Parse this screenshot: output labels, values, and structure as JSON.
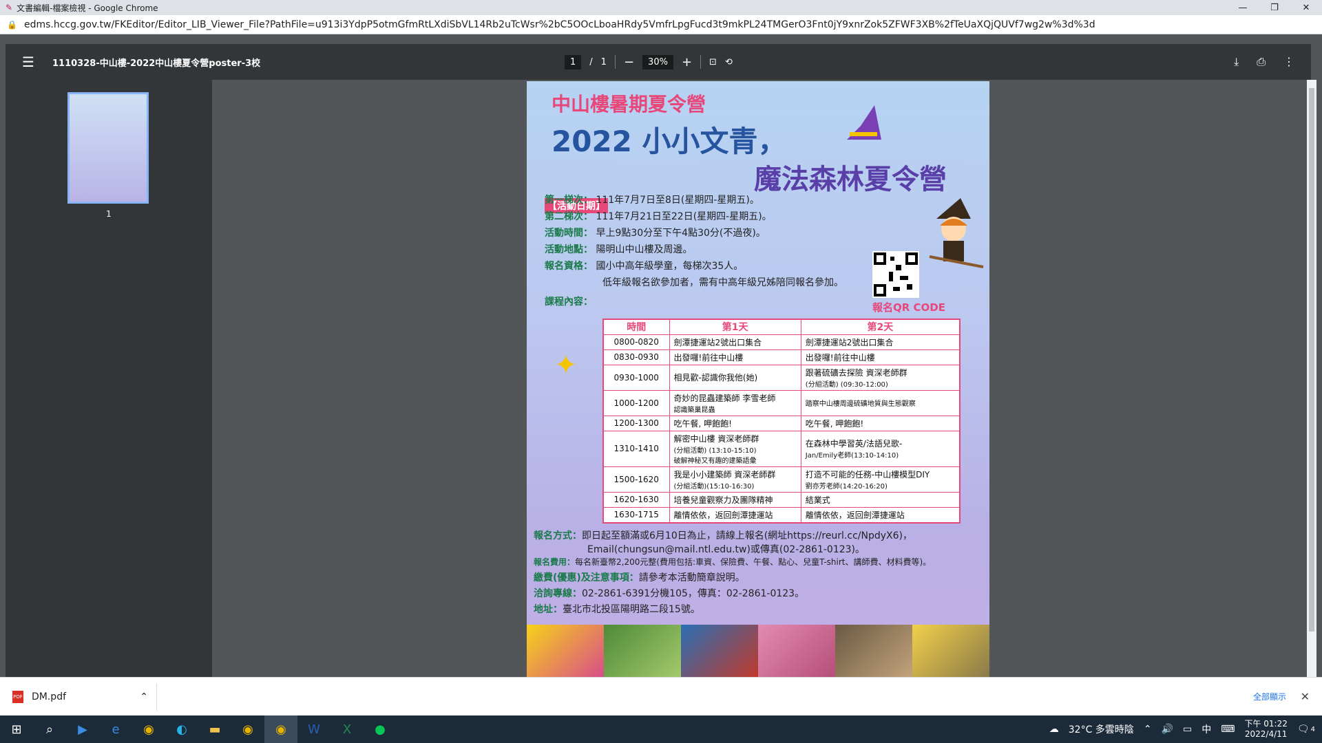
{
  "window": {
    "title": "文書編輯-檔案檢視 - Google Chrome"
  },
  "address": {
    "url": "edms.hccg.gov.tw/FKEditor/Editor_LIB_Viewer_File?PathFile=u913i3YdpP5otmGfmRtLXdiSbVL14Rb2uTcWsr%2bC5OOcLboaHRdy5VmfrLpgFucd3t9mkPL24TMGerO3Fnt0jY9xnrZok5ZFWF3XB%2fTeUaXQjQUVf7wg2w%3d%3d"
  },
  "pdf": {
    "doc_name": "1110328-中山樓-2022中山樓夏令營poster-3校",
    "page_current": "1",
    "page_sep": "/",
    "page_total": "1",
    "zoom": "30%",
    "thumb_label": "1"
  },
  "poster": {
    "line1": "中山樓暑期夏令營",
    "line2": "2022 小小文青，",
    "line3": "魔法森林夏令營",
    "date_tag": "【活動日期】",
    "batch1_k": "第一梯次：",
    "batch1_v": "111年7月7日至8日(星期四-星期五)。",
    "batch2_k": "第二梯次：",
    "batch2_v": "111年7月21日至22日(星期四-星期五)。",
    "time_k": "活動時間：",
    "time_v": "早上9點30分至下午4點30分(不過夜)。",
    "place_k": "活動地點：",
    "place_v": "陽明山中山樓及周邊。",
    "elig_k": "報名資格：",
    "elig_v": "國小中高年級學童，每梯次35人。",
    "elig_v2": "低年級報名欲參加者，需有中高年級兄姊陪同報名參加。",
    "qr_label": "報名QR CODE",
    "course_k": "課程內容：",
    "table_headers": [
      "時間",
      "第1天",
      "第2天"
    ],
    "rows": [
      {
        "t": "0800-0820",
        "d1": "劍潭捷運站2號出口集合",
        "d1b": "",
        "d2": "劍潭捷運站2號出口集合",
        "d2b": ""
      },
      {
        "t": "0830-0930",
        "d1": "出發囉!前往中山樓",
        "d1b": "",
        "d2": "出發囉!前往中山樓",
        "d2b": ""
      },
      {
        "t": "0930-1000",
        "d1": "相見歡-認識你我他(她)",
        "d1b": "",
        "d2": "跟著硫礦去探險 資深老師群",
        "d2b": "(分組活動) (09:30-12:00)"
      },
      {
        "t": "1000-1200",
        "d1": "奇妙的昆蟲建築師 李雪老師",
        "d1b": "認識築巢昆蟲",
        "d2": "",
        "d2b": "踏察中山樓周邊硫礦地質與生態觀察"
      },
      {
        "t": "1200-1300",
        "d1": "吃午餐, 呷飽飽!",
        "d1b": "",
        "d2": "吃午餐, 呷飽飽!",
        "d2b": ""
      },
      {
        "t": "1310-1410",
        "d1": "解密中山樓 資深老師群",
        "d1b": "(分組活動) (13:10-15:10)",
        "d1c": "破解神秘又有趣的建築語彙",
        "d2": "在森林中學習英/法語兒歌-",
        "d2b": "Jan/Emily老師(13:10-14:10)"
      },
      {
        "t": "1500-1620",
        "d1": "我是小小建築師 資深老師群",
        "d1b": "(分組活動)(15:10-16:30)",
        "d2": "打造不可能的任務-中山樓模型DIY",
        "d2b": "劉亦芳老師(14:20-16:20)"
      },
      {
        "t": "1620-1630",
        "d1": "培養兒童觀察力及團隊精神",
        "d1b": "",
        "d2": "結業式",
        "d2b": ""
      },
      {
        "t": "1630-1715",
        "d1": "離情依依，返回劍潭捷運站",
        "d1b": "",
        "d2": "離情依依，返回劍潭捷運站",
        "d2b": ""
      }
    ],
    "reg_k": "報名方式：",
    "reg_v": "即日起至額滿或6月10日為止，請線上報名(網址https://reurl.cc/NpdyX6)，",
    "reg_v2": "Email(chungsun@mail.ntl.edu.tw)或傳真(02-2861-0123)。",
    "fee_k": "報名費用：",
    "fee_v": "每名新臺幣2,200元整(費用包括:車資、保險費、午餐、點心、兒童T-shirt、講師費、材料費等)。",
    "note_k": "繳費(優惠)及注意事項：",
    "note_v": "請參考本活動簡章說明。",
    "tel_k": "洽詢專線：",
    "tel_v": "02-2861-6391分機105，傳真：02-2861-0123。",
    "addr_k": "地址：",
    "addr_v": "臺北市北投區陽明路二段15號。"
  },
  "download": {
    "file": "DM.pdf",
    "show_all": "全部顯示"
  },
  "taskbar": {
    "weather": "32°C 多雲時陰",
    "ime": "中",
    "time": "下午 01:22",
    "date": "2022/4/11",
    "notif_count": "4"
  }
}
